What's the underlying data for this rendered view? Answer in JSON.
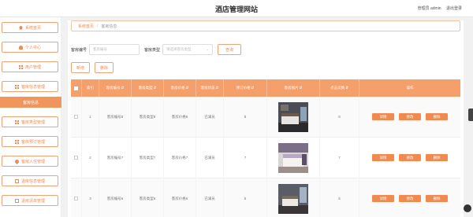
{
  "header": {
    "site_title": "酒店管理网站",
    "admin_label": "管理员 admin",
    "logout_label": "退出登录"
  },
  "sidebar": {
    "items": [
      {
        "label": "系统首页",
        "icon": "home-icon"
      },
      {
        "label": "个人中心",
        "icon": "user-icon"
      },
      {
        "label": "用户管理",
        "icon": "grid-icon"
      },
      {
        "label": "客房信息管理",
        "icon": "grid-icon"
      },
      {
        "label": "客房信息",
        "icon": "grid-icon",
        "active": true
      },
      {
        "label": "客房类型管理",
        "icon": "grid-icon"
      },
      {
        "label": "客房预订管理",
        "icon": "grid-icon"
      },
      {
        "label": "客房入住管理",
        "icon": "pin-icon"
      },
      {
        "label": "退房信息管理",
        "icon": "doc-icon"
      },
      {
        "label": "退房清单管理",
        "icon": "doc-icon"
      }
    ]
  },
  "breadcrumb": {
    "home": "系统首页",
    "sep": "/",
    "current": "客房信息"
  },
  "search": {
    "room_no_label": "客房编号",
    "room_no_placeholder": "客房编号",
    "room_type_label": "客房类型",
    "room_type_placeholder": "请选择客房类型",
    "query_label": "查询"
  },
  "actions": {
    "add_label": "新增",
    "delete_label": "删除"
  },
  "table": {
    "headers": [
      "索引",
      "客房编号",
      "客房类型",
      "客房价格",
      "客房状态",
      "预订价格",
      "客房照片",
      "点击次数",
      "操作"
    ],
    "rows": [
      {
        "index": "1",
        "room_no": "客房编号8",
        "room_type": "客房类型8",
        "room_price": "客房价格8",
        "status": "已满员",
        "book_price": "8",
        "clicks": "8"
      },
      {
        "index": "2",
        "room_no": "客房编号7",
        "room_type": "客房类型7",
        "room_price": "客房价格7",
        "status": "已满员",
        "book_price": "7",
        "clicks": "7"
      },
      {
        "index": "3",
        "room_no": "客房编号6",
        "room_type": "客房类型6",
        "room_price": "客房价格6",
        "status": "已满员",
        "book_price": "6",
        "clicks": "6"
      }
    ],
    "row_actions": {
      "detail": "详情",
      "edit": "修改",
      "delete": "删除"
    }
  },
  "colors": {
    "accent": "#f08a4f",
    "header_bg": "#f5a06b"
  }
}
